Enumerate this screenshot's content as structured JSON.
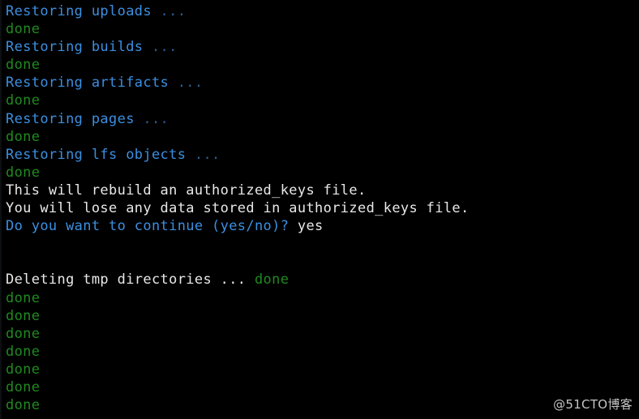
{
  "terminal": {
    "background_color": "#000000",
    "default_text_color": "#e8e8e8",
    "blue_color": "#3b8fe0",
    "dim_blue_color": "#2b5f92",
    "green_color": "#1f8a1f",
    "lines": [
      {
        "segments": [
          {
            "text": "Restoring uploads ",
            "color": "blue"
          },
          {
            "text": "...",
            "color": "dimblue"
          }
        ]
      },
      {
        "segments": [
          {
            "text": "done",
            "color": "green"
          }
        ]
      },
      {
        "segments": [
          {
            "text": "Restoring builds ",
            "color": "blue"
          },
          {
            "text": "...",
            "color": "dimblue"
          }
        ]
      },
      {
        "segments": [
          {
            "text": "done",
            "color": "green"
          }
        ]
      },
      {
        "segments": [
          {
            "text": "Restoring artifacts ",
            "color": "blue"
          },
          {
            "text": "...",
            "color": "dimblue"
          }
        ]
      },
      {
        "segments": [
          {
            "text": "done",
            "color": "green"
          }
        ]
      },
      {
        "segments": [
          {
            "text": "Restoring pages ",
            "color": "blue"
          },
          {
            "text": "...",
            "color": "dimblue"
          }
        ]
      },
      {
        "segments": [
          {
            "text": "done",
            "color": "green"
          }
        ]
      },
      {
        "segments": [
          {
            "text": "Restoring lfs objects ",
            "color": "blue"
          },
          {
            "text": "...",
            "color": "dimblue"
          }
        ]
      },
      {
        "segments": [
          {
            "text": "done",
            "color": "green"
          }
        ]
      },
      {
        "segments": [
          {
            "text": "This will rebuild an authorized_keys file.",
            "color": "white"
          }
        ]
      },
      {
        "segments": [
          {
            "text": "You will lose any data stored in authorized_keys file.",
            "color": "white"
          }
        ]
      },
      {
        "segments": [
          {
            "text": "Do you want to continue (yes/no)? ",
            "color": "blue"
          },
          {
            "text": "yes",
            "color": "white"
          }
        ]
      },
      {
        "segments": [
          {
            "text": "",
            "color": "white"
          }
        ]
      },
      {
        "segments": [
          {
            "text": "",
            "color": "white"
          }
        ]
      },
      {
        "segments": [
          {
            "text": "Deleting tmp directories ",
            "color": "white"
          },
          {
            "text": "... ",
            "color": "white"
          },
          {
            "text": "done",
            "color": "green"
          }
        ]
      },
      {
        "segments": [
          {
            "text": "done",
            "color": "green"
          }
        ]
      },
      {
        "segments": [
          {
            "text": "done",
            "color": "green"
          }
        ]
      },
      {
        "segments": [
          {
            "text": "done",
            "color": "green"
          }
        ]
      },
      {
        "segments": [
          {
            "text": "done",
            "color": "green"
          }
        ]
      },
      {
        "segments": [
          {
            "text": "done",
            "color": "green"
          }
        ]
      },
      {
        "segments": [
          {
            "text": "done",
            "color": "green"
          }
        ]
      },
      {
        "segments": [
          {
            "text": "done",
            "color": "green"
          }
        ]
      }
    ]
  },
  "watermark": {
    "text": "@51CTO博客"
  }
}
